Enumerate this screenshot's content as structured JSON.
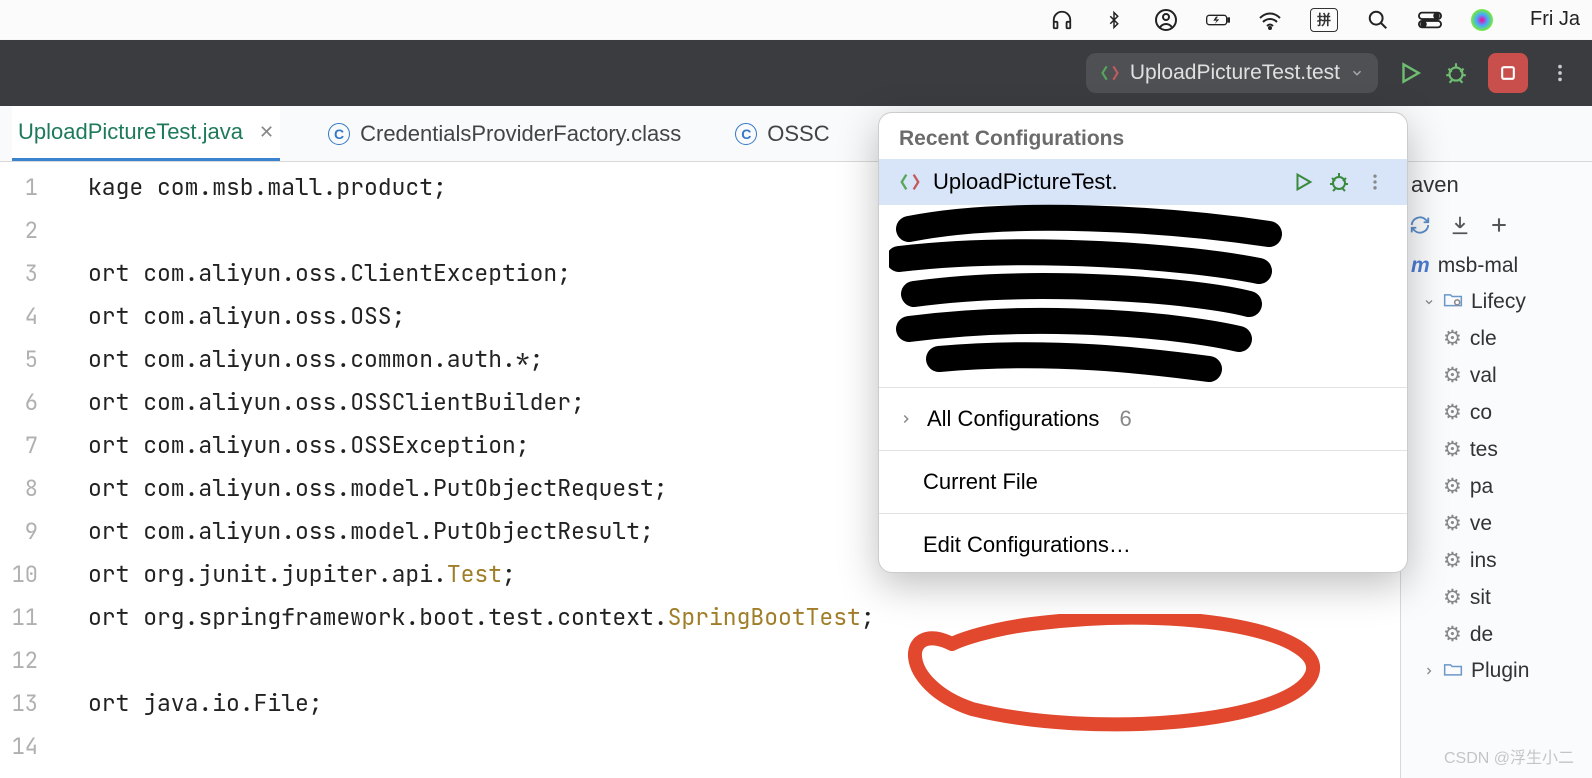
{
  "menubar": {
    "date": "Fri Ja",
    "ime": "拼"
  },
  "toolbar": {
    "config_label": "UploadPictureTest.test"
  },
  "tabs": [
    {
      "label": "UploadPictureTest.java",
      "active": true,
      "closable": true,
      "icon": "none"
    },
    {
      "label": "CredentialsProviderFactory.class",
      "active": false,
      "closable": false,
      "icon": "C"
    },
    {
      "label": "OSSC",
      "active": false,
      "closable": false,
      "icon": "C"
    }
  ],
  "gutter": [
    "1",
    "2",
    "3",
    "4",
    "5",
    "6",
    "7",
    "8",
    "9",
    "10",
    "11",
    "12",
    "13",
    "14"
  ],
  "code": {
    "l1a": "kage",
    "l1b": " com.msb.mall.product;",
    "l3a": "ort",
    "l3b": " com.aliyun.oss.ClientException;",
    "l4a": "ort",
    "l4b": " com.aliyun.oss.OSS;",
    "l5a": "ort",
    "l5b": " com.aliyun.oss.common.auth.*;",
    "l6a": "ort",
    "l6b": " com.aliyun.oss.OSSClientBuilder;",
    "l7a": "ort",
    "l7b": " com.aliyun.oss.OSSException;",
    "l8a": "ort",
    "l8b": " com.aliyun.oss.model.PutObjectRequest;",
    "l9a": "ort",
    "l9b": " com.aliyun.oss.model.PutObjectResult;",
    "l10a": "ort",
    "l10b": " org.junit.jupiter.api.",
    "l10c": "Test",
    "l10d": ";",
    "l11a": "ort",
    "l11b": " org.springframework.boot.test.context.",
    "l11c": "SpringBootTest",
    "l11d": ";",
    "l13a": "ort",
    "l13b": " java.io.File;"
  },
  "popup": {
    "header": "Recent Configurations",
    "item1": "UploadPictureTest.",
    "all_label": "All Configurations",
    "all_count": "6",
    "current_file": "Current File",
    "edit": "Edit Configurations…"
  },
  "maven": {
    "title": "aven",
    "root": "msb-mal",
    "lifecycle": "Lifecy",
    "goals": [
      "cle",
      "val",
      "co",
      "tes",
      "pa",
      "ve",
      "ins",
      "sit",
      "de"
    ],
    "plugins": "Plugin"
  },
  "watermark": "CSDN @浮生小二"
}
